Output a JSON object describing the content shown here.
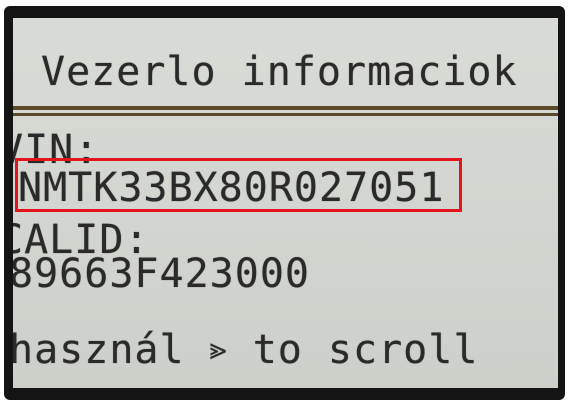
{
  "screen": {
    "title": "Vezerlo informaciok",
    "vin_label": "VIN:",
    "vin_value": "NMTK33BX80R027051",
    "calid_label": "CALID:",
    "calid_value": "89663F423000",
    "footer_prefix": "használ",
    "footer_suffix": "to scroll",
    "scroll_icon": "up-down-arrows-icon",
    "highlight_color": "#e3141c"
  }
}
